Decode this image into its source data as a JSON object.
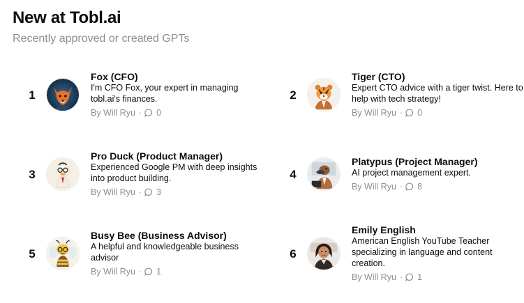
{
  "header": {
    "title": "New at Tobl.ai",
    "subtitle": "Recently approved or created GPTs"
  },
  "gpts": [
    {
      "rank": "1",
      "name": "Fox (CFO)",
      "description": "I'm CFO Fox, your expert in managing tobl.ai's finances.",
      "author": "By Will Ryu",
      "separator": "·",
      "conversations": "0",
      "avatar_icon": "fox-avatar-icon"
    },
    {
      "rank": "2",
      "name": "Tiger (CTO)",
      "description": "Expert CTO advice with a tiger twist. Here to help with tech strategy!",
      "author": "By Will Ryu",
      "separator": "·",
      "conversations": "0",
      "avatar_icon": "tiger-avatar-icon"
    },
    {
      "rank": "3",
      "name": "Pro Duck (Product Manager)",
      "description": "Experienced Google PM with deep insights into product building.",
      "author": "By Will Ryu",
      "separator": "·",
      "conversations": "3",
      "avatar_icon": "duck-avatar-icon"
    },
    {
      "rank": "4",
      "name": "Platypus (Project Manager)",
      "description": "AI project management expert.",
      "author": "By Will Ryu",
      "separator": "·",
      "conversations": "8",
      "avatar_icon": "platypus-avatar-icon"
    },
    {
      "rank": "5",
      "name": "Busy Bee (Business Advisor)",
      "description": "A helpful and knowledgeable business advisor",
      "author": "By Will Ryu",
      "separator": "·",
      "conversations": "1",
      "avatar_icon": "bee-avatar-icon"
    },
    {
      "rank": "6",
      "name": "Emily English",
      "description": "American English YouTube Teacher specializing in language and content creation.",
      "author": "By Will Ryu",
      "separator": "·",
      "conversations": "1",
      "avatar_icon": "teacher-avatar-icon"
    }
  ]
}
